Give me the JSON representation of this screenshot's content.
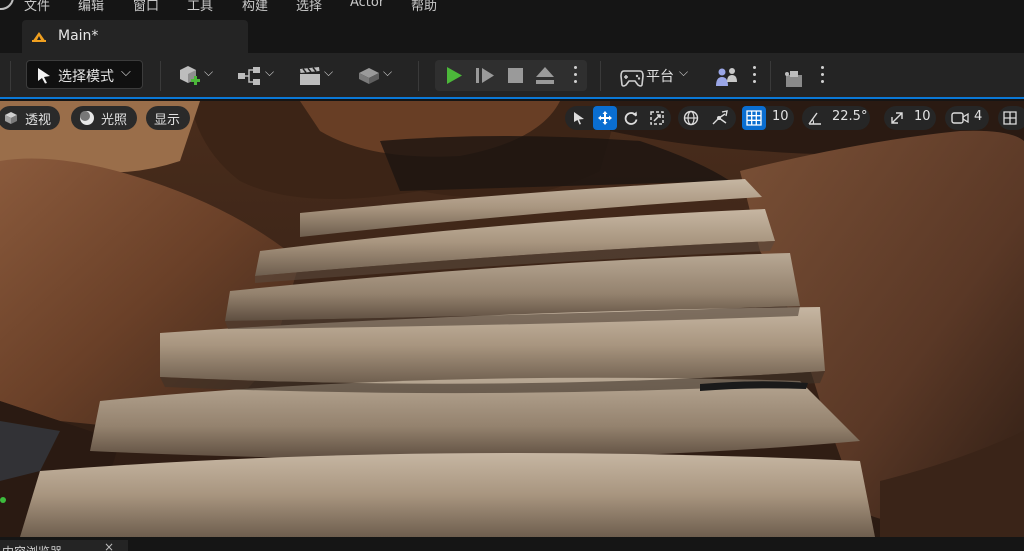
{
  "menubar": {
    "items": [
      {
        "label": "文件"
      },
      {
        "label": "编辑"
      },
      {
        "label": "窗口"
      },
      {
        "label": "工具"
      },
      {
        "label": "构建"
      },
      {
        "label": "选择"
      },
      {
        "label": "Actor"
      },
      {
        "label": "帮助"
      }
    ]
  },
  "tab": {
    "label": "Main*"
  },
  "toolbar": {
    "mode_label": "选择模式",
    "platform_label": "平台"
  },
  "viewport": {
    "perspective_label": "透视",
    "lighting_label": "光照",
    "show_label": "显示",
    "grid_snap": "10",
    "rotation_snap": "22.5°",
    "scale_snap": "10",
    "camera_speed": "4"
  },
  "bottom": {
    "panel_label": "内容浏览器",
    "close_glyph": "×"
  },
  "colors": {
    "accent_blue": "#0a6ed1",
    "play_green": "#4cb83a",
    "tab_icon_orange": "#f0a020"
  }
}
